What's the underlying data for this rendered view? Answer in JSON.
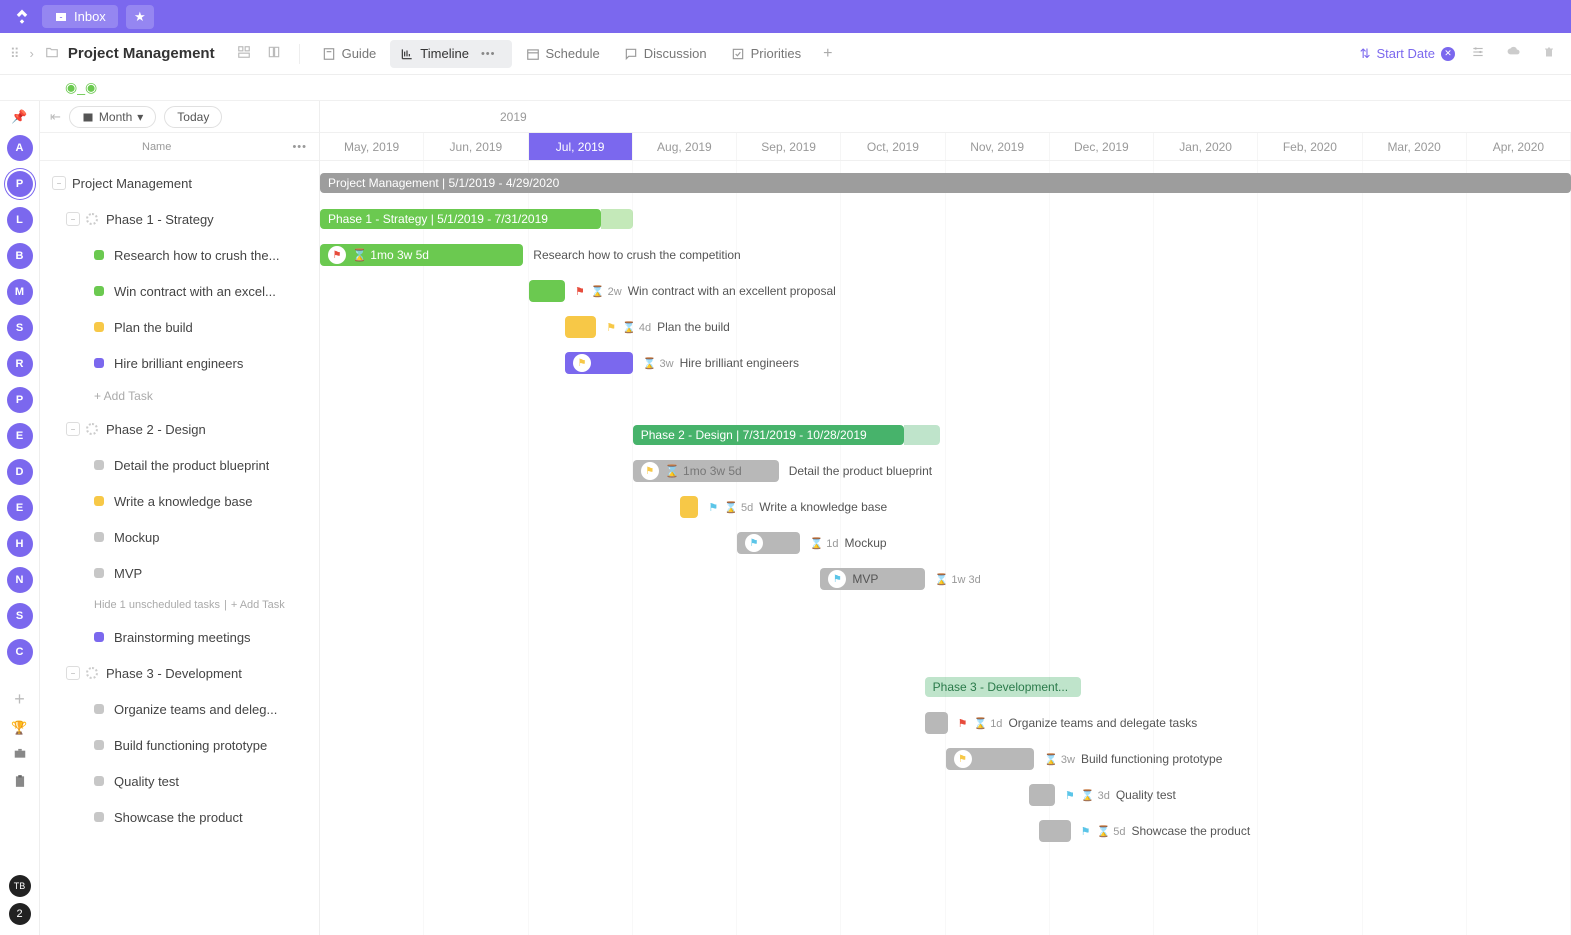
{
  "topbar": {
    "inbox": "Inbox"
  },
  "toolbar": {
    "title": "Project Management",
    "tabs": [
      {
        "label": "Guide"
      },
      {
        "label": "Timeline"
      },
      {
        "label": "Schedule"
      },
      {
        "label": "Discussion"
      },
      {
        "label": "Priorities"
      }
    ],
    "start_date": "Start Date"
  },
  "controls": {
    "month": "Month",
    "today": "Today"
  },
  "col_name": "Name",
  "year": "2019",
  "months": [
    "May, 2019",
    "Jun, 2019",
    "Jul, 2019",
    "Aug, 2019",
    "Sep, 2019",
    "Oct, 2019",
    "Nov, 2019",
    "Dec, 2019",
    "Jan, 2020",
    "Feb, 2020",
    "Mar, 2020",
    "Apr, 2020"
  ],
  "active_month_index": 2,
  "tree": {
    "root": "Project Management",
    "phases": [
      {
        "name": "Phase 1 - Strategy",
        "tasks": [
          {
            "name": "Research how to crush the...",
            "color": "#6bc950"
          },
          {
            "name": "Win contract with an excel...",
            "color": "#6bc950"
          },
          {
            "name": "Plan the build",
            "color": "#f7c847"
          },
          {
            "name": "Hire brilliant engineers",
            "color": "#7b68ee"
          }
        ],
        "add": "+ Add Task"
      },
      {
        "name": "Phase 2 - Design",
        "tasks": [
          {
            "name": "Detail the product blueprint",
            "color": "#c7c7c7"
          },
          {
            "name": "Write a knowledge base",
            "color": "#f7c847"
          },
          {
            "name": "Mockup",
            "color": "#c7c7c7"
          },
          {
            "name": "MVP",
            "color": "#c7c7c7"
          }
        ],
        "hide": "Hide 1 unscheduled tasks",
        "add2": "+ Add Task",
        "extra": {
          "name": "Brainstorming meetings",
          "color": "#7b68ee"
        }
      },
      {
        "name": "Phase 3 - Development",
        "tasks": [
          {
            "name": "Organize teams and deleg...",
            "color": "#c7c7c7"
          },
          {
            "name": "Build functioning prototype",
            "color": "#c7c7c7"
          },
          {
            "name": "Quality test",
            "color": "#c7c7c7"
          },
          {
            "name": "Showcase the product",
            "color": "#c7c7c7"
          }
        ]
      }
    ]
  },
  "gantt": {
    "pm_bar": "Project Management | 5/1/2019 - 4/29/2020",
    "p1_bar": "Phase 1 - Strategy | 5/1/2019 - 7/31/2019",
    "p1_t1_dur": "1mo 3w 5d",
    "p1_t1": "Research how to crush the competition",
    "p1_t2_dur": "2w",
    "p1_t2": "Win contract with an excellent proposal",
    "p1_t3_dur": "4d",
    "p1_t3": "Plan the build",
    "p1_t4_dur": "3w",
    "p1_t4": "Hire brilliant engineers",
    "p2_bar": "Phase 2 - Design | 7/31/2019 - 10/28/2019",
    "p2_t1_dur": "1mo 3w 5d",
    "p2_t1": "Detail the product blueprint",
    "p2_t2_dur": "5d",
    "p2_t2": "Write a knowledge base",
    "p2_t3_dur": "1d",
    "p2_t3": "Mockup",
    "p2_t4": "MVP",
    "p2_t4_dur": "1w 3d",
    "p3_bar": "Phase 3 - Development...",
    "p3_t1_dur": "1d",
    "p3_t1": "Organize teams and delegate tasks",
    "p3_t2_dur": "3w",
    "p3_t2": "Build functioning prototype",
    "p3_t3_dur": "3d",
    "p3_t3": "Quality test",
    "p3_t4_dur": "5d",
    "p3_t4": "Showcase the product"
  },
  "avatars": [
    "A",
    "P",
    "L",
    "B",
    "M",
    "S",
    "R",
    "P",
    "E",
    "D",
    "E",
    "H",
    "N",
    "S",
    "C"
  ],
  "bottom_badge": "TB",
  "bottom_count": "2"
}
